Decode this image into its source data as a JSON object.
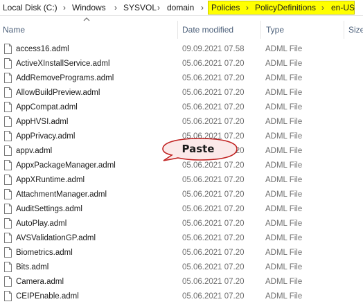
{
  "breadcrumb": {
    "items": [
      "Local Disk (C:)",
      "Windows",
      "SYSVOL",
      "domain",
      "Policies",
      "PolicyDefinitions",
      "en-US"
    ],
    "separator": "›",
    "highlight_color": "#ffff00"
  },
  "columns": {
    "name": "Name",
    "date": "Date modified",
    "type": "Type",
    "size": "Size"
  },
  "files": [
    {
      "name": "access16.adml",
      "date": "09.09.2021 07.58",
      "type": "ADML File"
    },
    {
      "name": "ActiveXInstallService.adml",
      "date": "05.06.2021 07.20",
      "type": "ADML File"
    },
    {
      "name": "AddRemovePrograms.adml",
      "date": "05.06.2021 07.20",
      "type": "ADML File"
    },
    {
      "name": "AllowBuildPreview.adml",
      "date": "05.06.2021 07.20",
      "type": "ADML File"
    },
    {
      "name": "AppCompat.adml",
      "date": "05.06.2021 07.20",
      "type": "ADML File"
    },
    {
      "name": "AppHVSI.adml",
      "date": "05.06.2021 07.20",
      "type": "ADML File"
    },
    {
      "name": "AppPrivacy.adml",
      "date": "05.06.2021 07.20",
      "type": "ADML File"
    },
    {
      "name": "appv.adml",
      "date": "05.06.2021 07.20",
      "type": "ADML File"
    },
    {
      "name": "AppxPackageManager.adml",
      "date": "05.06.2021 07.20",
      "type": "ADML File"
    },
    {
      "name": "AppXRuntime.adml",
      "date": "05.06.2021 07.20",
      "type": "ADML File"
    },
    {
      "name": "AttachmentManager.adml",
      "date": "05.06.2021 07.20",
      "type": "ADML File"
    },
    {
      "name": "AuditSettings.adml",
      "date": "05.06.2021 07.20",
      "type": "ADML File"
    },
    {
      "name": "AutoPlay.adml",
      "date": "05.06.2021 07.20",
      "type": "ADML File"
    },
    {
      "name": "AVSValidationGP.adml",
      "date": "05.06.2021 07.20",
      "type": "ADML File"
    },
    {
      "name": "Biometrics.adml",
      "date": "05.06.2021 07.20",
      "type": "ADML File"
    },
    {
      "name": "Bits.adml",
      "date": "05.06.2021 07.20",
      "type": "ADML File"
    },
    {
      "name": "Camera.adml",
      "date": "05.06.2021 07.20",
      "type": "ADML File"
    },
    {
      "name": "CEIPEnable.adml",
      "date": "05.06.2021 07.20",
      "type": "ADML File"
    }
  ],
  "callout": {
    "text": "Paste",
    "fill": "#fbe9e9",
    "border": "#c0201f"
  },
  "icons": {
    "file": "document-icon",
    "sort": "sort-up-icon"
  }
}
